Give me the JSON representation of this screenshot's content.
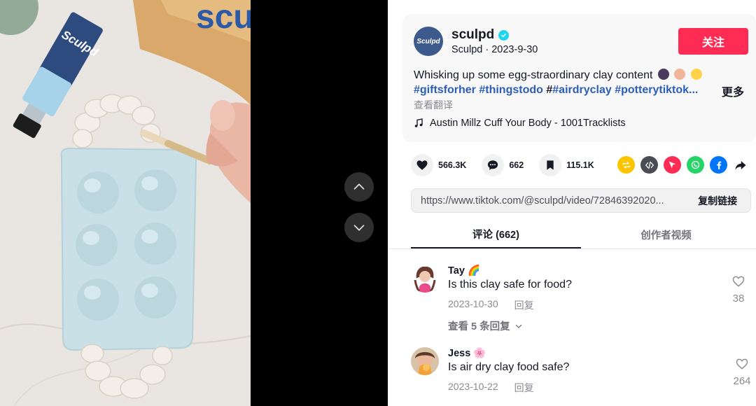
{
  "video": {
    "tube_brand": "Sculpd",
    "bag_brand": "scu"
  },
  "nav": {
    "up_icon": "chevron-up-icon",
    "down_icon": "chevron-down-icon"
  },
  "author": {
    "avatar_text": "Sculpd",
    "username": "sculpd",
    "display_name": "Sculpd",
    "separator": " · ",
    "date": "2023-9-30",
    "follow_label": "关注"
  },
  "post": {
    "description": "Whisking up some egg-straordinary clay content",
    "hashtags": {
      "first": "#giftsforher",
      "second": "#thingstodo",
      "prefix": "#",
      "third": "#airdryclay",
      "fourth": "#potterytiktok..."
    },
    "more_label": "更多",
    "translate_label": "查看翻译",
    "music": "Austin Millz Cuff Your Body - 1001Tracklists"
  },
  "stats": {
    "likes": "566.3K",
    "comments": "662",
    "saves": "115.1K"
  },
  "share": {
    "icons": [
      "repost-icon",
      "embed-icon",
      "send-icon",
      "whatsapp-icon",
      "facebook-icon",
      "share-arrow-icon"
    ],
    "colors": {
      "repost": "#ffc400",
      "embed": "#4c4c54",
      "send": "#fe2c55",
      "whatsapp": "#25d366",
      "facebook": "#0075fa"
    }
  },
  "link": {
    "url": "https://www.tiktok.com/@sculpd/video/72846392020...",
    "copy_label": "复制链接"
  },
  "tabs": {
    "comments": "评论 (662)",
    "creator_videos": "创作者视频"
  },
  "comments": [
    {
      "name": "Tay 🌈",
      "text": "Is this clay safe for food?",
      "date": "2023-10-30",
      "reply_label": "回复",
      "likes": "38",
      "view_replies": "查看 5 条回复"
    },
    {
      "name": "Jess 🌸",
      "text": "Is air dry clay food safe?",
      "date": "2023-10-22",
      "reply_label": "回复",
      "likes": "264"
    }
  ],
  "colors": {
    "accent": "#fe2c55",
    "hashtag": "#2b5db9",
    "verified": "#20d5ec"
  }
}
